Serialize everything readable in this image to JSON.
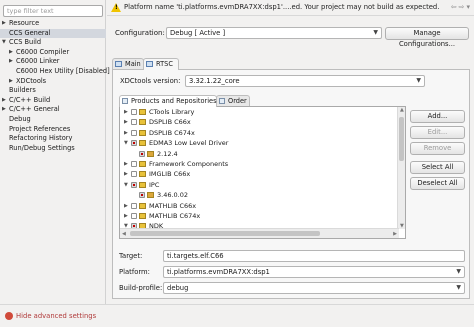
{
  "window": {
    "width": 474,
    "height": 327
  },
  "left_panel": {
    "filter_placeholder": "type filter text",
    "tree": [
      {
        "label": "Resource",
        "expanded": false
      },
      {
        "label": "CCS General",
        "selected": true
      },
      {
        "label": "CCS Build",
        "expanded": true
      },
      {
        "label": "C6000 Compiler",
        "expanded": false
      },
      {
        "label": "C6000 Linker",
        "expanded": false
      },
      {
        "label": "C6000 Hex Utility [Disabled]"
      },
      {
        "label": "XDCtools",
        "expanded": false
      },
      {
        "label": "Builders"
      },
      {
        "label": "C/C++ Build",
        "expanded": false
      },
      {
        "label": "C/C++ General",
        "expanded": false
      },
      {
        "label": "Debug"
      },
      {
        "label": "Project References"
      },
      {
        "label": "Refactoring History"
      },
      {
        "label": "Run/Debug Settings"
      }
    ]
  },
  "message_bar": {
    "text": "Platform name 'ti.platforms.evmDRA7XX:dsp1'....ed. Your project may not build as expected."
  },
  "configuration": {
    "label": "Configuration:",
    "value": "Debug  [ Active ]",
    "manage_button": "Manage Configurations..."
  },
  "tabs": [
    {
      "label": "Main",
      "active": false
    },
    {
      "label": "RTSC",
      "active": true
    }
  ],
  "rtsc": {
    "xdc_label": "XDCtools version:",
    "xdc_value": "3.32.1.22_core",
    "inner_tabs": [
      {
        "label": "Products and Repositories",
        "active": true
      },
      {
        "label": "Order",
        "active": false
      }
    ],
    "products": [
      {
        "label": "CTools Library",
        "level": 0,
        "expander": "closed",
        "checked": false
      },
      {
        "label": "DSPLIB C66x",
        "level": 0,
        "expander": "closed",
        "checked": false
      },
      {
        "label": "DSPLIB C674x",
        "level": 0,
        "expander": "closed",
        "checked": false
      },
      {
        "label": "EDMA3 Low Level Driver",
        "level": 0,
        "expander": "open",
        "checked": true
      },
      {
        "label": "2.12.4",
        "level": 1,
        "expander": "",
        "checked": true
      },
      {
        "label": "Framework Components",
        "level": 0,
        "expander": "closed",
        "checked": false
      },
      {
        "label": "IMGLIB C66x",
        "level": 0,
        "expander": "closed",
        "checked": false
      },
      {
        "label": "IPC",
        "level": 0,
        "expander": "open",
        "checked": true
      },
      {
        "label": "3.46.0.02",
        "level": 1,
        "expander": "",
        "checked": true
      },
      {
        "label": "MATHLIB C66x",
        "level": 0,
        "expander": "closed",
        "checked": false
      },
      {
        "label": "MATHLIB C674x",
        "level": 0,
        "expander": "closed",
        "checked": false
      },
      {
        "label": "NDK",
        "level": 0,
        "expander": "open",
        "checked": true
      }
    ],
    "buttons": {
      "add": "Add...",
      "edit": "Edit...",
      "remove": "Remove",
      "select_all": "Select All",
      "deselect_all": "Deselect All"
    },
    "target_label": "Target:",
    "target_value": "ti.targets.elf.C66",
    "platform_label": "Platform:",
    "platform_value": "ti.platforms.evmDRA7XX:dsp1",
    "build_profile_label": "Build-profile:",
    "build_profile_value": "debug"
  },
  "footer": {
    "hide_advanced": "Hide advanced settings"
  },
  "colors": {
    "warning": "#f0c400",
    "hide_link": "#b03a3a",
    "selection": "#d3d7de"
  }
}
